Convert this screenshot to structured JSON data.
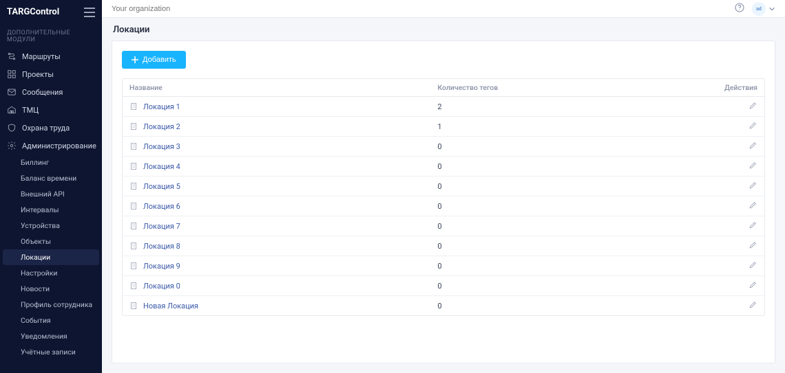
{
  "brand": "TARGControl",
  "topbar": {
    "org_placeholder": "Your organization",
    "avatar_text": "ad",
    "help_icon": "help"
  },
  "sidebar": {
    "section_title": "ДОПОЛНИТЕЛЬНЫЕ МОДУЛИ",
    "items": [
      {
        "label": "Маршруты",
        "icon": "route"
      },
      {
        "label": "Проекты",
        "icon": "projects"
      },
      {
        "label": "Сообщения",
        "icon": "messages"
      },
      {
        "label": "ТМЦ",
        "icon": "inventory"
      },
      {
        "label": "Охрана труда",
        "icon": "shield"
      },
      {
        "label": "Администрирование",
        "icon": "gear",
        "expandable": true
      }
    ],
    "admin_sub": [
      "Биллинг",
      "Баланс времени",
      "Внешний API",
      "Интервалы",
      "Устройства",
      "Объекты",
      "Локации",
      "Настройки",
      "Новости",
      "Профиль сотрудника",
      "События",
      "Уведомления",
      "Учётные записи"
    ],
    "active_sub": "Локации"
  },
  "page": {
    "title": "Локации",
    "add_button": "Добавить",
    "table": {
      "headers": {
        "name": "Название",
        "tags": "Количество тегов",
        "actions": "Действия"
      },
      "rows": [
        {
          "name": "Локация 1",
          "tags": "2"
        },
        {
          "name": "Локация 2",
          "tags": "1"
        },
        {
          "name": "Локация 3",
          "tags": "0"
        },
        {
          "name": "Локация 4",
          "tags": "0"
        },
        {
          "name": "Локация 5",
          "tags": "0"
        },
        {
          "name": "Локация 6",
          "tags": "0"
        },
        {
          "name": "Локация 7",
          "tags": "0"
        },
        {
          "name": "Локация 8",
          "tags": "0"
        },
        {
          "name": "Локация 9",
          "tags": "0"
        },
        {
          "name": "Локация 0",
          "tags": "0"
        },
        {
          "name": "Новая Локация",
          "tags": "0"
        }
      ]
    }
  }
}
